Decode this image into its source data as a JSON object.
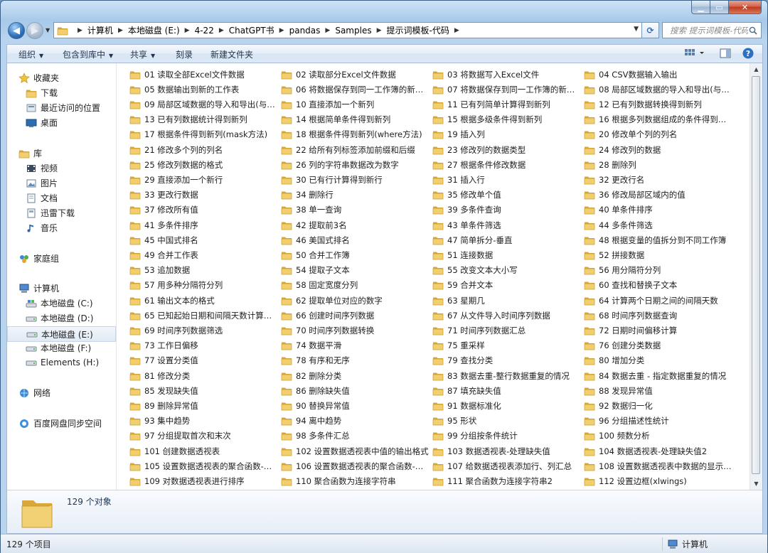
{
  "window": {
    "caption_buttons": [
      "minimize",
      "maximize",
      "close"
    ]
  },
  "address": {
    "breadcrumbs": [
      "计算机",
      "本地磁盘 (E:)",
      "4-22",
      "ChatGPT书",
      "pandas",
      "Samples",
      "提示词模板-代码"
    ],
    "search_placeholder": "搜索 提示词模板-代码"
  },
  "toolbar": {
    "organize": "组织",
    "include_in_library": "包含到库中",
    "share": "共享",
    "burn": "刻录",
    "new_folder": "新建文件夹"
  },
  "sidebar": {
    "favorites": "收藏夹",
    "downloads": "下载",
    "recent": "最近访问的位置",
    "desktop": "桌面",
    "libraries": "库",
    "videos": "视频",
    "pictures": "图片",
    "documents": "文档",
    "xunlei": "迅雷下载",
    "music": "音乐",
    "homegroup": "家庭组",
    "computer": "计算机",
    "drive_c": "本地磁盘 (C:)",
    "drive_d": "本地磁盘 (D:)",
    "drive_e": "本地磁盘 (E:)",
    "drive_f": "本地磁盘 (F:)",
    "drive_h": "Elements (H:)",
    "network": "网络",
    "baidu": "百度网盘同步空间"
  },
  "files": [
    "01 读取全部Excel文件数据",
    "02 读取部分Excel文件数据",
    "03 将数据写入Excel文件",
    "04 CSV数据输入输出",
    "05 数据输出到新的工作表",
    "06 将数据保存到同一工作簿的新工...",
    "07 将数据保存到同一工作簿的新工...",
    "08 局部区域数据的导入和导出(与xl...",
    "09 局部区域数据的导入和导出(与O...",
    "10 直接添加一个新列",
    "11 已有列简单计算得到新列",
    "12 已有列数据转换得到新列",
    "13 已有列数据统计得到新列",
    "14 根据简单条件得到新列",
    "15 根据多级条件得到新列",
    "16 根据多列数据组成的条件得到新列",
    "17 根据条件得到新列(mask方法)",
    "18 根据条件得到新列(where方法)",
    "19 插入列",
    "20 修改单个列的列名",
    "21 修改多个列的列名",
    "22 给所有列标签添加前缀和后缀",
    "23 修改列的数据类型",
    "24 修改列的数据",
    "25 修改列数据的格式",
    "26 列的字符串数据改为数字",
    "27 根据条件修改数据",
    "28 删除列",
    "29 直接添加一个新行",
    "30 已有行计算得到新行",
    "31 插入行",
    "32 更改行名",
    "33 更改行数据",
    "34 删除行",
    "35 修改单个值",
    "36 修改局部区域内的值",
    "37 修改所有值",
    "38 单一查询",
    "39 多条件查询",
    "40 单条件排序",
    "41 多条件排序",
    "42 提取前3名",
    "43 单条件筛选",
    "44 多条件筛选",
    "45 中国式排名",
    "46 美国式排名",
    "47 简单拆分-垂直",
    "48 根据变量的值拆分到不同工作簿",
    "49 合并工作表",
    "50 合并工作簿",
    "51 连接数据",
    "52 拼接数据",
    "53 追加数据",
    "54 提取子文本",
    "55 改变文本大小写",
    "56 用分隔符分列",
    "57 用多种分隔符分列",
    "58 固定宽度分列",
    "59 合并文本",
    "60 查找和替换子文本",
    "61 输出文本的格式",
    "62 提取单位对应的数字",
    "63 星期几",
    "64 计算两个日期之间的间隔天数",
    "65 已知起始日期和间隔天数计算终...",
    "66 创建时间序列数据",
    "67 从文件导入时间序列数据",
    "68 时间序列数据查询",
    "69 时间序列数据筛选",
    "70 时间序列数据转换",
    "71 时间序列数据汇总",
    "72 日期时间偏移计算",
    "73 工作日偏移",
    "74 数据平滑",
    "75 重采样",
    "76 创建分类数据",
    "77 设置分类值",
    "78 有序和无序",
    "79 查找分类",
    "80 增加分类",
    "81 修改分类",
    "82 删除分类",
    "83 数据去重-整行数据重复的情况",
    "84 数据去重 - 指定数据重复的情况",
    "85 发现缺失值",
    "86 删除缺失值",
    "87 填充缺失值",
    "88 发现异常值",
    "89 删除异常值",
    "90 替换异常值",
    "91 数据标准化",
    "92 数据归一化",
    "93 集中趋势",
    "94 离中趋势",
    "95 形状",
    "96 分组描述性统计",
    "97 分组提取首次和末次",
    "98 多条件汇总",
    "99 分组按条件统计",
    "100 频数分析",
    "101 创建数据透视表",
    "102 设置数据透视表中值的输出格式",
    "103 数据透视表-处理缺失值",
    "104 数据透视表-处理缺失值2",
    "105 设置数据透视表的聚合函数-求和",
    "106 设置数据透视表的聚合函数-次数",
    "107 给数据透视表添加行、列汇总",
    "108 设置数据透视表中数据的显示方...",
    "109 对数据透视表进行排序",
    "110 聚合函数为连接字符串",
    "111 聚合函数为连接字符串2",
    "112 设置边框(xlwings)"
  ],
  "details": {
    "count": "129 个对象"
  },
  "status": {
    "items": "129 个项目",
    "location": "计算机"
  },
  "colors": {
    "folder": "#e9c25a",
    "accent": "#2a70c0"
  }
}
